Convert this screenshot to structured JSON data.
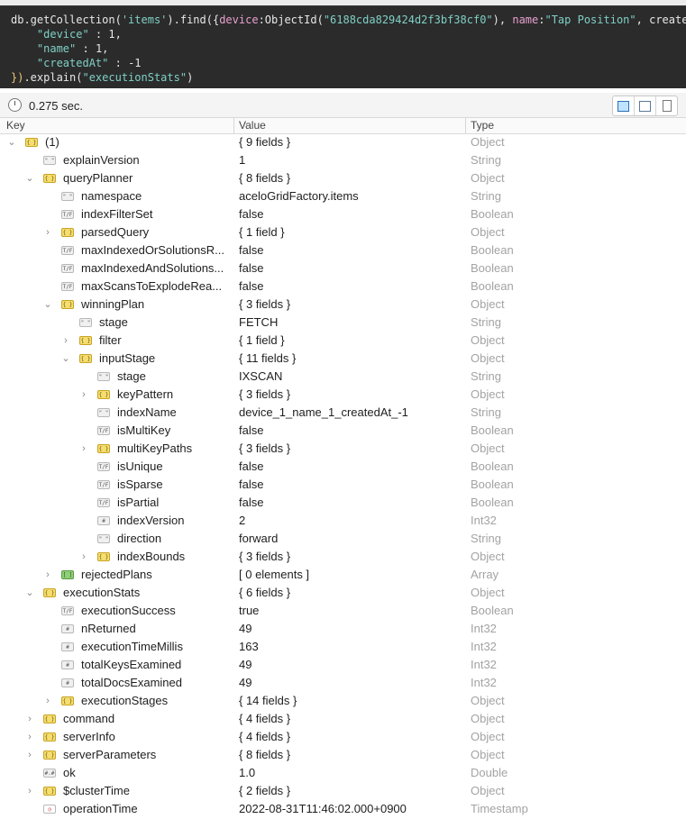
{
  "editor": {
    "lines": [
      [
        {
          "t": "db.getCollection(",
          "c": "fn"
        },
        {
          "t": "'items'",
          "c": "str"
        },
        {
          "t": ").find({",
          "c": "fn"
        },
        {
          "t": "device",
          "c": "key"
        },
        {
          "t": ":ObjectId(",
          "c": "fn"
        },
        {
          "t": "\"6188cda829424d2f3bf38cf0\"",
          "c": "str"
        },
        {
          "t": "), ",
          "c": "fn"
        },
        {
          "t": "name",
          "c": "key"
        },
        {
          "t": ":",
          "c": "fn"
        },
        {
          "t": "\"Tap Position\"",
          "c": "str"
        },
        {
          "t": ", createdAt",
          "c": "fn"
        }
      ],
      [
        {
          "t": "    ",
          "c": "fn"
        },
        {
          "t": "\"device\"",
          "c": "str"
        },
        {
          "t": " : 1,",
          "c": "fn"
        }
      ],
      [
        {
          "t": "    ",
          "c": "fn"
        },
        {
          "t": "\"name\"",
          "c": "str"
        },
        {
          "t": " : 1,",
          "c": "fn"
        }
      ],
      [
        {
          "t": "    ",
          "c": "fn"
        },
        {
          "t": "\"createdAt\"",
          "c": "str"
        },
        {
          "t": " : -1",
          "c": "fn"
        }
      ],
      [
        {
          "t": "})",
          "c": "punc"
        },
        {
          "t": ".explain(",
          "c": "fn"
        },
        {
          "t": "\"executionStats\"",
          "c": "str"
        },
        {
          "t": ")",
          "c": "fn"
        }
      ]
    ]
  },
  "status": {
    "time": "0.275 sec."
  },
  "view_buttons": [
    "tree-view",
    "table-view",
    "text-view"
  ],
  "columns": {
    "key": "Key",
    "value": "Value",
    "type": "Type"
  },
  "rows": [
    {
      "level": 0,
      "arrow": "down",
      "icon": "obj",
      "key": "(1)",
      "value": "{ 9 fields }",
      "type": "Object"
    },
    {
      "level": 1,
      "arrow": "",
      "icon": "str",
      "key": "explainVersion",
      "value": "1",
      "type": "String"
    },
    {
      "level": 1,
      "arrow": "down",
      "icon": "obj",
      "key": "queryPlanner",
      "value": "{ 8 fields }",
      "type": "Object"
    },
    {
      "level": 2,
      "arrow": "",
      "icon": "str",
      "key": "namespace",
      "value": "aceloGridFactory.items",
      "type": "String"
    },
    {
      "level": 2,
      "arrow": "",
      "icon": "bool",
      "key": "indexFilterSet",
      "value": "false",
      "type": "Boolean"
    },
    {
      "level": 2,
      "arrow": "right",
      "icon": "obj",
      "key": "parsedQuery",
      "value": "{ 1 field }",
      "type": "Object"
    },
    {
      "level": 2,
      "arrow": "",
      "icon": "bool",
      "key": "maxIndexedOrSolutionsR...",
      "value": "false",
      "type": "Boolean"
    },
    {
      "level": 2,
      "arrow": "",
      "icon": "bool",
      "key": "maxIndexedAndSolutions...",
      "value": "false",
      "type": "Boolean"
    },
    {
      "level": 2,
      "arrow": "",
      "icon": "bool",
      "key": "maxScansToExplodeRea...",
      "value": "false",
      "type": "Boolean"
    },
    {
      "level": 2,
      "arrow": "down",
      "icon": "obj",
      "key": "winningPlan",
      "value": "{ 3 fields }",
      "type": "Object"
    },
    {
      "level": 3,
      "arrow": "",
      "icon": "str",
      "key": "stage",
      "value": "FETCH",
      "type": "String"
    },
    {
      "level": 3,
      "arrow": "right",
      "icon": "obj",
      "key": "filter",
      "value": "{ 1 field }",
      "type": "Object"
    },
    {
      "level": 3,
      "arrow": "down",
      "icon": "obj",
      "key": "inputStage",
      "value": "{ 11 fields }",
      "type": "Object"
    },
    {
      "level": 4,
      "arrow": "",
      "icon": "str",
      "key": "stage",
      "value": "IXSCAN",
      "type": "String"
    },
    {
      "level": 4,
      "arrow": "right",
      "icon": "obj",
      "key": "keyPattern",
      "value": "{ 3 fields }",
      "type": "Object"
    },
    {
      "level": 4,
      "arrow": "",
      "icon": "str",
      "key": "indexName",
      "value": "device_1_name_1_createdAt_-1",
      "type": "String"
    },
    {
      "level": 4,
      "arrow": "",
      "icon": "bool",
      "key": "isMultiKey",
      "value": "false",
      "type": "Boolean"
    },
    {
      "level": 4,
      "arrow": "right",
      "icon": "obj",
      "key": "multiKeyPaths",
      "value": "{ 3 fields }",
      "type": "Object"
    },
    {
      "level": 4,
      "arrow": "",
      "icon": "bool",
      "key": "isUnique",
      "value": "false",
      "type": "Boolean"
    },
    {
      "level": 4,
      "arrow": "",
      "icon": "bool",
      "key": "isSparse",
      "value": "false",
      "type": "Boolean"
    },
    {
      "level": 4,
      "arrow": "",
      "icon": "bool",
      "key": "isPartial",
      "value": "false",
      "type": "Boolean"
    },
    {
      "level": 4,
      "arrow": "",
      "icon": "int",
      "key": "indexVersion",
      "value": "2",
      "type": "Int32"
    },
    {
      "level": 4,
      "arrow": "",
      "icon": "str",
      "key": "direction",
      "value": "forward",
      "type": "String"
    },
    {
      "level": 4,
      "arrow": "right",
      "icon": "obj",
      "key": "indexBounds",
      "value": "{ 3 fields }",
      "type": "Object"
    },
    {
      "level": 2,
      "arrow": "right",
      "icon": "arr",
      "key": "rejectedPlans",
      "value": "[ 0 elements ]",
      "type": "Array"
    },
    {
      "level": 1,
      "arrow": "down",
      "icon": "obj",
      "key": "executionStats",
      "value": "{ 6 fields }",
      "type": "Object"
    },
    {
      "level": 2,
      "arrow": "",
      "icon": "bool",
      "key": "executionSuccess",
      "value": "true",
      "type": "Boolean"
    },
    {
      "level": 2,
      "arrow": "",
      "icon": "int",
      "key": "nReturned",
      "value": "49",
      "type": "Int32"
    },
    {
      "level": 2,
      "arrow": "",
      "icon": "int",
      "key": "executionTimeMillis",
      "value": "163",
      "type": "Int32"
    },
    {
      "level": 2,
      "arrow": "",
      "icon": "int",
      "key": "totalKeysExamined",
      "value": "49",
      "type": "Int32"
    },
    {
      "level": 2,
      "arrow": "",
      "icon": "int",
      "key": "totalDocsExamined",
      "value": "49",
      "type": "Int32"
    },
    {
      "level": 2,
      "arrow": "right",
      "icon": "obj",
      "key": "executionStages",
      "value": "{ 14 fields }",
      "type": "Object"
    },
    {
      "level": 1,
      "arrow": "right",
      "icon": "obj",
      "key": "command",
      "value": "{ 4 fields }",
      "type": "Object"
    },
    {
      "level": 1,
      "arrow": "right",
      "icon": "obj",
      "key": "serverInfo",
      "value": "{ 4 fields }",
      "type": "Object"
    },
    {
      "level": 1,
      "arrow": "right",
      "icon": "obj",
      "key": "serverParameters",
      "value": "{ 8 fields }",
      "type": "Object"
    },
    {
      "level": 1,
      "arrow": "",
      "icon": "dbl",
      "key": "ok",
      "value": "1.0",
      "type": "Double"
    },
    {
      "level": 1,
      "arrow": "right",
      "icon": "obj",
      "key": "$clusterTime",
      "value": "{ 2 fields }",
      "type": "Object"
    },
    {
      "level": 1,
      "arrow": "",
      "icon": "ts",
      "key": "operationTime",
      "value": "2022-08-31T11:46:02.000+0900",
      "type": "Timestamp"
    }
  ]
}
